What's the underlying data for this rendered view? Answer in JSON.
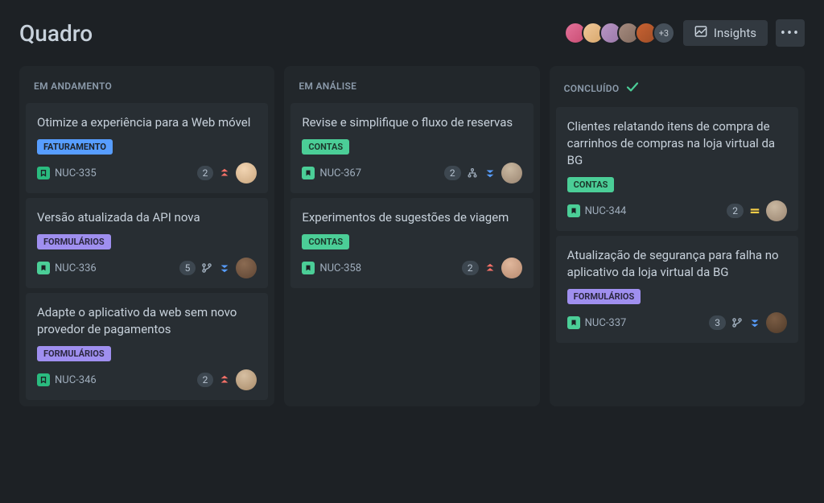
{
  "header": {
    "title": "Quadro",
    "insights_label": "Insights",
    "overflow_count": "+3"
  },
  "columns": [
    {
      "title": "EM ANDAMENTO",
      "done": false,
      "cards": [
        {
          "title": "Otimize a experiência para a Web móvel",
          "tag": {
            "label": "FATURAMENTO",
            "color": "blue"
          },
          "key": "NUC-335",
          "issue_color": "teal",
          "count": "2",
          "priority": "highest",
          "branch": false,
          "subtask": false,
          "assignee": "as-1"
        },
        {
          "title": "Versão atualizada da API nova",
          "tag": {
            "label": "FORMULÁRIOS",
            "color": "purple"
          },
          "key": "NUC-336",
          "issue_color": "green",
          "count": "5",
          "priority": "low",
          "branch": true,
          "subtask": false,
          "assignee": "as-2"
        },
        {
          "title": "Adapte o aplicativo da web sem novo provedor de pagamentos",
          "tag": {
            "label": "FORMULÁRIOS",
            "color": "purple"
          },
          "key": "NUC-346",
          "issue_color": "teal",
          "count": "2",
          "priority": "highest",
          "branch": false,
          "subtask": false,
          "assignee": "as-3"
        }
      ]
    },
    {
      "title": "EM ANÁLISE",
      "done": false,
      "cards": [
        {
          "title": "Revise e simplifique o fluxo de reservas",
          "tag": {
            "label": "CONTAS",
            "color": "teal"
          },
          "key": "NUC-367",
          "issue_color": "green",
          "count": "2",
          "priority": "low",
          "branch": false,
          "subtask": true,
          "assignee": "as-4"
        },
        {
          "title": "Experimentos de sugestões de viagem",
          "tag": {
            "label": "CONTAS",
            "color": "teal"
          },
          "key": "NUC-358",
          "issue_color": "green",
          "count": "2",
          "priority": "highest",
          "branch": false,
          "subtask": false,
          "assignee": "as-5"
        }
      ]
    },
    {
      "title": "CONCLUÍDO",
      "done": true,
      "cards": [
        {
          "title": "Clientes relatando itens de compra de carrinhos de compras na loja virtual da BG",
          "tag": {
            "label": "CONTAS",
            "color": "teal"
          },
          "key": "NUC-344",
          "issue_color": "green",
          "count": "2",
          "priority": "medium",
          "branch": false,
          "subtask": false,
          "assignee": "as-4"
        },
        {
          "title": "Atualização de segurança para falha no aplicativo da loja virtual da BG",
          "tag": {
            "label": "FORMULÁRIOS",
            "color": "purple"
          },
          "key": "NUC-337",
          "issue_color": "green",
          "count": "3",
          "priority": "lowest",
          "branch": true,
          "subtask": false,
          "assignee": "as-6"
        }
      ]
    }
  ]
}
